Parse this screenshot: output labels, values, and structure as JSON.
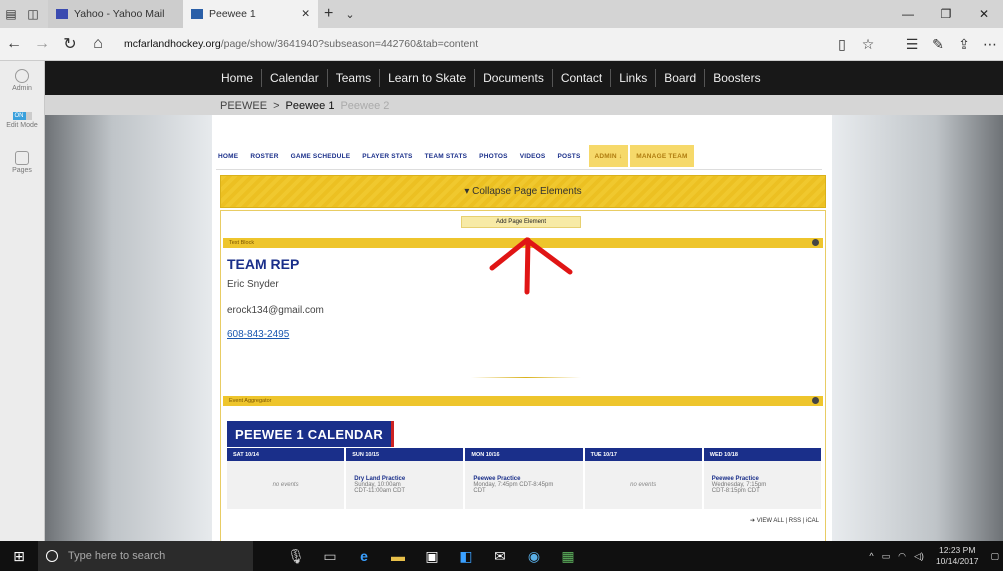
{
  "browser": {
    "tabs": [
      {
        "title": "Yahoo - Yahoo Mail",
        "active": false
      },
      {
        "title": "Peewee 1",
        "active": true
      }
    ],
    "url": {
      "host": "mcfarlandhockey.org",
      "path": "/page/show/3641940?subseason=442760&tab=content"
    }
  },
  "admin_sidebar": {
    "admin_label": "Admin",
    "edit_mode_label": "Edit Mode",
    "toggle_on": "ON",
    "pages_label": "Pages"
  },
  "site": {
    "main_nav": [
      "Home",
      "Calendar",
      "Teams",
      "Learn to Skate",
      "Documents",
      "Contact",
      "Links",
      "Board",
      "Boosters"
    ],
    "breadcrumb": {
      "root": "PEEWEE",
      "sep": ">",
      "current": "Peewee 1",
      "sibling": "Peewee 2"
    },
    "page_tabs": [
      "HOME",
      "ROSTER",
      "GAME SCHEDULE",
      "PLAYER STATS",
      "TEAM STATS",
      "PHOTOS",
      "VIDEOS",
      "POSTS"
    ],
    "admin_tabs": [
      "ADMIN ↓",
      "MANAGE TEAM"
    ],
    "collapse_label": "▾ Collapse Page Elements",
    "add_element_label": "Add Page Element",
    "text_block": {
      "bar_label": "Text Block",
      "title": "TEAM REP",
      "name": "Eric Snyder",
      "email": "erock134@gmail.com",
      "phone": "608-843-2495"
    },
    "event_block": {
      "bar_label": "Event Aggregator",
      "title": "PEEWEE 1 CALENDAR",
      "days": [
        {
          "header": "SAT 10/14",
          "empty": "no events"
        },
        {
          "header": "SUN 10/15",
          "event": "Dry Land Practice",
          "detail1": "Sunday, 10:00am",
          "detail2": "CDT-11:00am CDT"
        },
        {
          "header": "MON 10/16",
          "event": "Peewee Practice",
          "detail1": "Monday, 7:45pm CDT-8:45pm",
          "detail2": "CDT"
        },
        {
          "header": "TUE 10/17",
          "empty": "no events"
        },
        {
          "header": "WED 10/18",
          "event": "Peewee Practice",
          "detail1": "Wednesday, 7:15pm",
          "detail2": "CDT-8:15pm CDT"
        }
      ],
      "links": "➔ VIEW ALL | RSS | iCAL"
    }
  },
  "taskbar": {
    "search_placeholder": "Type here to search",
    "time": "12:23 PM",
    "date": "10/14/2017"
  },
  "colors": {
    "accent_gold": "#f0c82e",
    "navy": "#1a2f8a",
    "arrow_red": "#e01515"
  }
}
